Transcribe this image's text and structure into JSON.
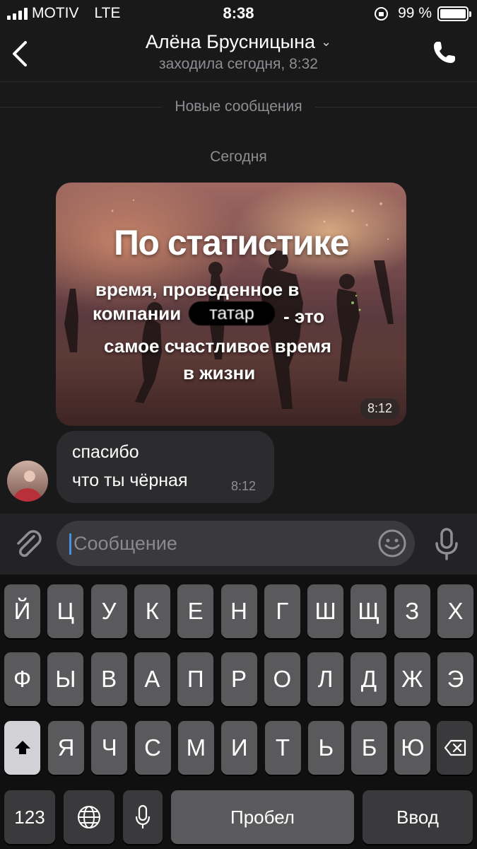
{
  "status_bar": {
    "carrier": "MOTIV",
    "network": "LTE",
    "time": "8:38",
    "battery": "99 %"
  },
  "header": {
    "contact_name": "Алёна Брусницына",
    "last_seen": "заходила сегодня, 8:32"
  },
  "chat": {
    "new_messages_label": "Новые сообщения",
    "date_label": "Сегодня",
    "photo_message": {
      "headline": "По статистике",
      "line1": "время, проведенное в",
      "line2_start": "компании",
      "redacted_word": "татар",
      "line2_end": "- это",
      "line3": "самое счастливое время",
      "line4": "в  жизни",
      "time": "8:12"
    },
    "text_message": {
      "line1": "спасибо",
      "line2": "что ты чёрная",
      "time": "8:12"
    }
  },
  "composer": {
    "placeholder": "Сообщение"
  },
  "keyboard": {
    "row1": [
      "Й",
      "Ц",
      "У",
      "К",
      "Е",
      "Н",
      "Г",
      "Ш",
      "Щ",
      "З",
      "Х"
    ],
    "row2": [
      "Ф",
      "Ы",
      "В",
      "А",
      "П",
      "Р",
      "О",
      "Л",
      "Д",
      "Ж",
      "Э"
    ],
    "row3": [
      "Я",
      "Ч",
      "С",
      "М",
      "И",
      "Т",
      "Ь",
      "Б",
      "Ю"
    ],
    "numbers_label": "123",
    "space_label": "Пробел",
    "return_label": "Ввод"
  },
  "colors": {
    "background": "#19191a",
    "bubble": "#2c2c2e",
    "caret": "#4a90e2",
    "key": "#5a5a5c",
    "key_dark": "#3a3a3c"
  }
}
